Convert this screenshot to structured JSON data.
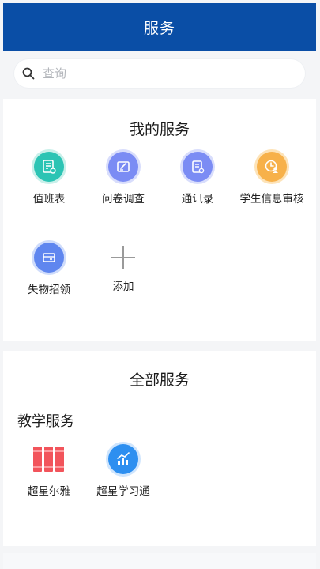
{
  "header": {
    "title": "服务"
  },
  "search": {
    "placeholder": "查询",
    "icon": "search-icon"
  },
  "my_services": {
    "title": "我的服务",
    "items": [
      {
        "label": "值班表",
        "icon": "duty-schedule-icon",
        "color": "#2cc4b4"
      },
      {
        "label": "问卷调查",
        "icon": "questionnaire-icon",
        "color": "#7b8cf4"
      },
      {
        "label": "通讯录",
        "icon": "contacts-icon",
        "color": "#7b8cf4"
      },
      {
        "label": "学生信息审核",
        "icon": "student-review-icon",
        "color": "#f7b14a"
      },
      {
        "label": "失物招领",
        "icon": "lost-and-found-icon",
        "color": "#5f86ef"
      }
    ],
    "add_label": "添加"
  },
  "all_services": {
    "title": "全部服务",
    "groups": [
      {
        "title": "教学服务",
        "items": [
          {
            "label": "超星尔雅",
            "icon": "books-icon",
            "color": "#f2545b"
          },
          {
            "label": "超星学习通",
            "icon": "chart-icon",
            "color": "#2d8ff0"
          }
        ]
      }
    ]
  }
}
